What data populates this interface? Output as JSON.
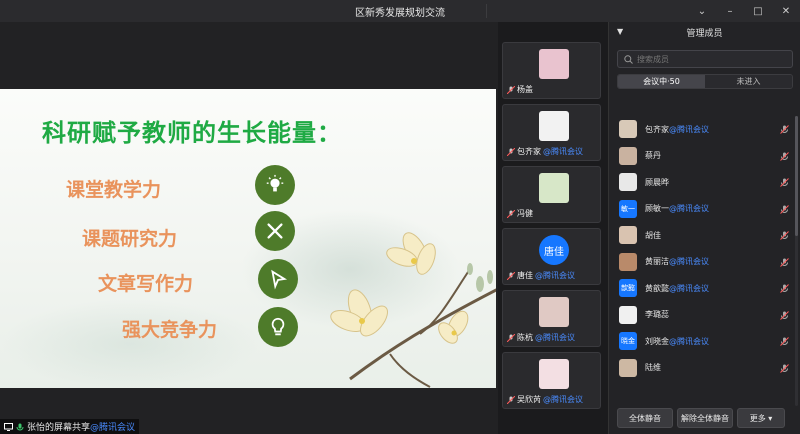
{
  "window": {
    "title": "区新秀发展规划交流",
    "buttons": [
      "⌄",
      "–",
      "□",
      "✕"
    ]
  },
  "slide": {
    "title": "科研赋予教师的生长能量：",
    "skills": [
      {
        "label": "课堂教学力",
        "icon": "lightbulb-icon"
      },
      {
        "label": "课题研究力",
        "icon": "tools-icon"
      },
      {
        "label": "文章写作力",
        "icon": "cursor-icon"
      },
      {
        "label": "强大竞争力",
        "icon": "idea-bulb-icon"
      }
    ],
    "colors": {
      "title": "#1faa44",
      "skill": "#e9935c",
      "icon_bg": "#4e7b2a"
    }
  },
  "share_badge": {
    "name": "张怡的屏幕共享",
    "tag": "@腾讯会议"
  },
  "video_tiles": [
    {
      "name": "杨盖",
      "tag": ""
    },
    {
      "name": "包齐家",
      "tag": "@腾讯会议"
    },
    {
      "name": "冯健",
      "tag": ""
    },
    {
      "name": "唐佳",
      "tag": "@腾讯会议",
      "avatar_text": "唐佳"
    },
    {
      "name": "陈杭",
      "tag": "@腾讯会议"
    },
    {
      "name": "吴欣芮",
      "tag": "@腾讯会议"
    }
  ],
  "members_panel": {
    "title": "管理成员",
    "search_placeholder": "搜索成员",
    "tab_in_meeting": "会议中·50",
    "tab_not_joined": "未进入",
    "members": [
      {
        "name": "包齐家",
        "tag": "@腾讯会议",
        "avatar_text": "",
        "avatar_color": "#d8c9b8"
      },
      {
        "name": "蔡丹",
        "tag": "",
        "avatar_text": "",
        "avatar_color": "#c9b2a0"
      },
      {
        "name": "顾晨晔",
        "tag": "",
        "avatar_text": "",
        "avatar_color": "#e8e8e8"
      },
      {
        "name": "顾敏一",
        "tag": "@腾讯会议",
        "avatar_text": "敏一",
        "avatar_color": "#1677ff"
      },
      {
        "name": "胡佳",
        "tag": "",
        "avatar_text": "",
        "avatar_color": "#d9c3b0"
      },
      {
        "name": "黄丽洁",
        "tag": "@腾讯会议",
        "avatar_text": "",
        "avatar_color": "#b98a6a"
      },
      {
        "name": "黄歆懿",
        "tag": "@腾讯会议",
        "avatar_text": "歆懿",
        "avatar_color": "#1677ff"
      },
      {
        "name": "李璐蕊",
        "tag": "",
        "avatar_text": "",
        "avatar_color": "#f0f0f0"
      },
      {
        "name": "刘晓金",
        "tag": "@腾讯会议",
        "avatar_text": "晓金",
        "avatar_color": "#1677ff"
      },
      {
        "name": "陆维",
        "tag": "",
        "avatar_text": "",
        "avatar_color": "#cdb8a3"
      }
    ],
    "footer": {
      "mute_all": "全体静音",
      "unmute_all": "解除全体静音",
      "more": "更多 ▾"
    }
  }
}
